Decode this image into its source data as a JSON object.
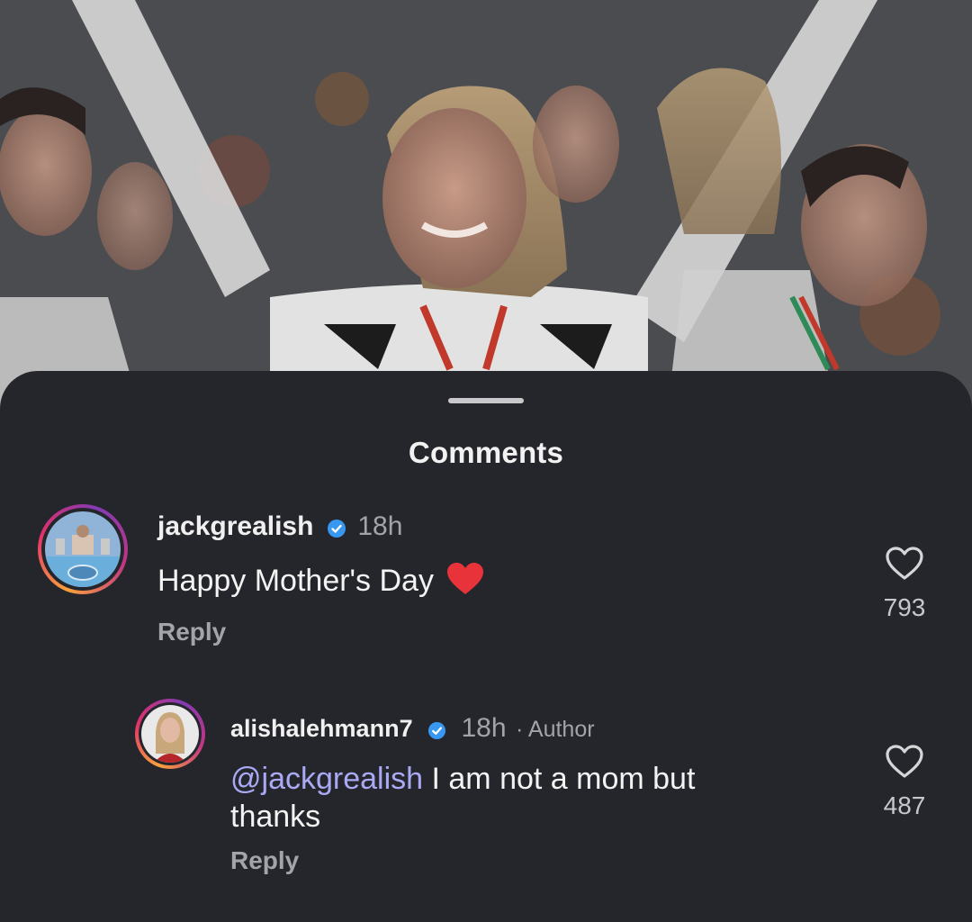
{
  "sheet": {
    "title": "Comments"
  },
  "comments": [
    {
      "username": "jackgrealish",
      "verified": true,
      "time": "18h",
      "text": "Happy Mother's Day",
      "emoji": "red-heart-emoji",
      "reply_label": "Reply",
      "likes": "793"
    },
    {
      "username": "alishalehmann7",
      "verified": true,
      "time": "18h",
      "author_label": "· Author",
      "mention": "@jackgrealish",
      "text": " I am not a mom but thanks",
      "reply_label": "Reply",
      "likes": "487"
    }
  ],
  "icons": {
    "like": "heart-outline-icon",
    "verified": "verified-badge-icon"
  },
  "colors": {
    "sheet_bg": "#25262b",
    "verified_blue": "#3897f0",
    "mention": "#a9a9f5",
    "heart_red": "#e8333a"
  }
}
